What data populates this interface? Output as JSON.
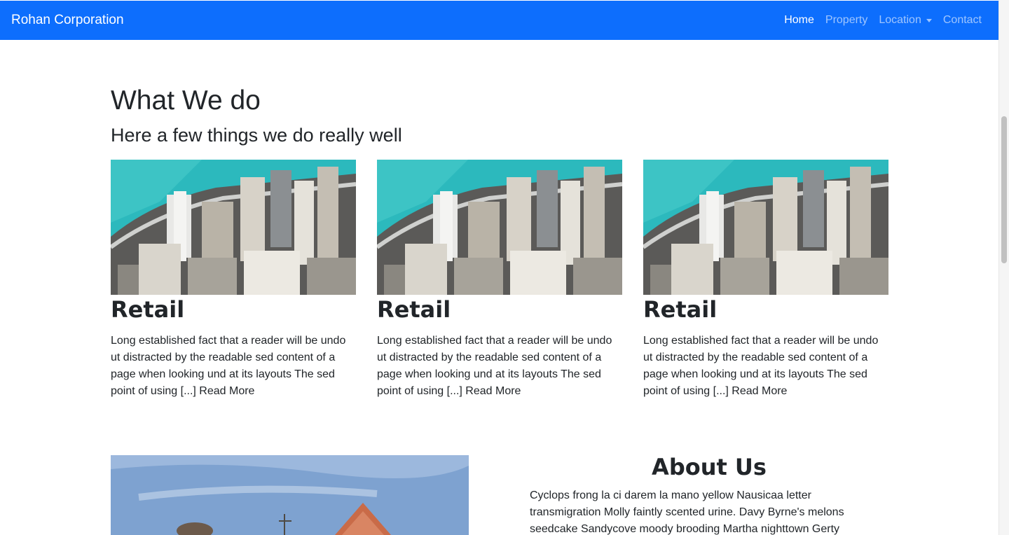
{
  "navbar": {
    "brand": "Rohan Corporation",
    "links": [
      {
        "label": "Home"
      },
      {
        "label": "Property"
      },
      {
        "label": "Location"
      },
      {
        "label": "Contact"
      }
    ],
    "colors": {
      "background": "#0d6efd",
      "active": "#ffffff",
      "inactive": "rgba(255,255,255,0.6)"
    }
  },
  "services": {
    "title": "What We do",
    "subtitle": "Here a few things we do really well",
    "cards": [
      {
        "title": "Retail",
        "text": "Long established fact that a reader will be undo ut distracted by the readable sed content of a page when looking und at its layouts The sed point of using [...] ",
        "link": "Read More"
      },
      {
        "title": "Retail",
        "text": "Long established fact that a reader will be undo ut distracted by the readable sed content of a page when looking und at its layouts The sed point of using [...] ",
        "link": "Read More"
      },
      {
        "title": "Retail",
        "text": "Long established fact that a reader will be undo ut distracted by the readable sed content of a page when looking und at its layouts The sed point of using [...] ",
        "link": "Read More"
      }
    ]
  },
  "about": {
    "title": "About Us",
    "text": "Cyclops frong la ci darem la mano yellow Nausicaa letter transmigration Molly faintly scented urine. Davy Byrne's melons seedcake Sandycove moody brooding Martha nighttown Gerty"
  }
}
